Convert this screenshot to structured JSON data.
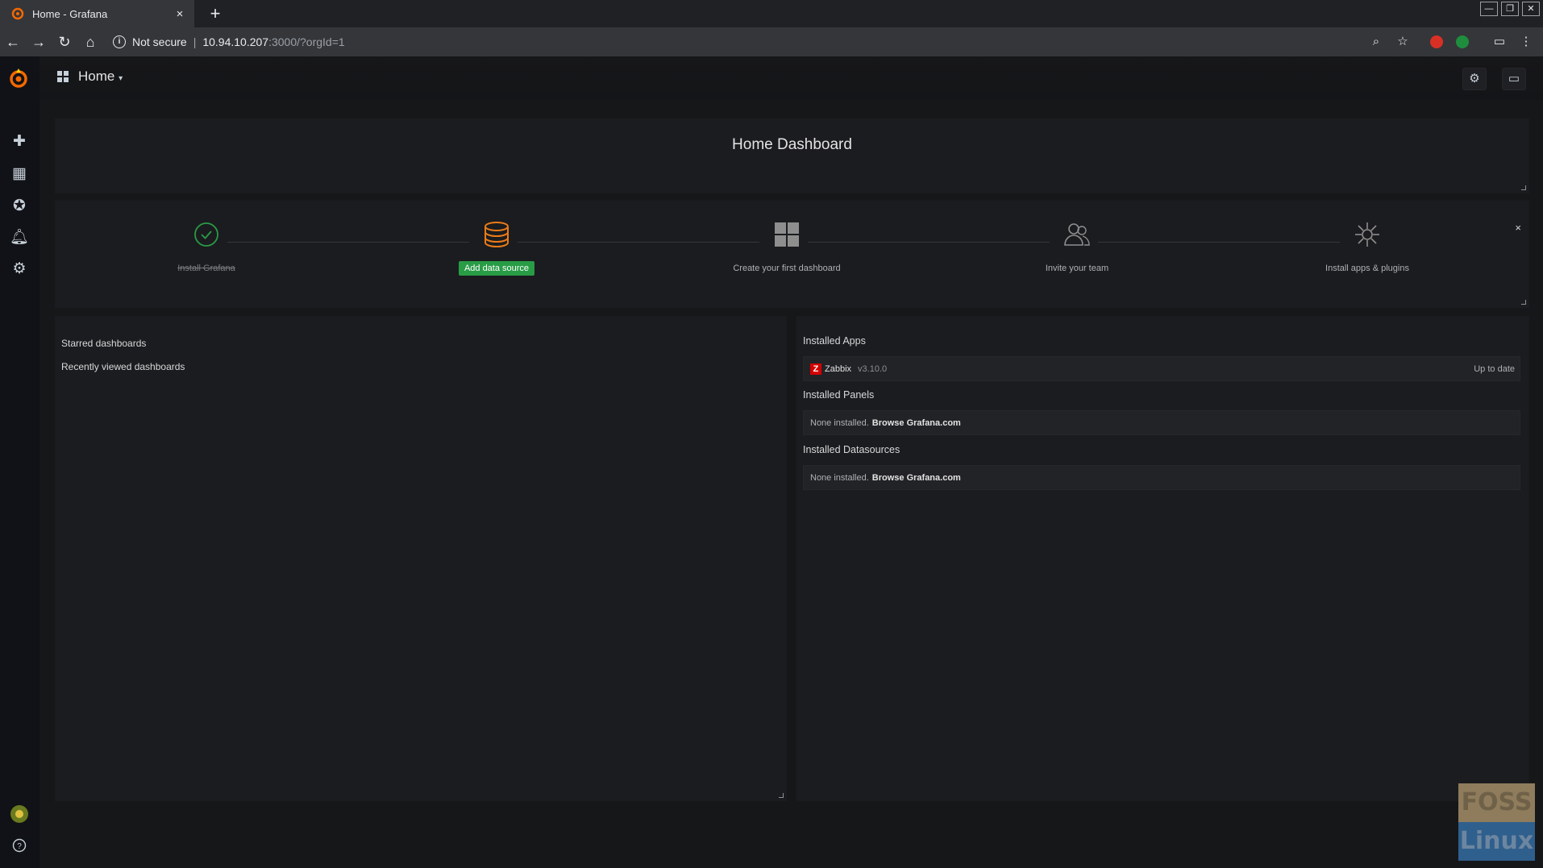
{
  "browser": {
    "tab_title": "Home - Grafana",
    "new_tab": "+",
    "tab_close": "×",
    "not_secure": "Not secure",
    "url_host": "10.94.10.207",
    "url_path": ":3000/?orgId=1",
    "separator": "|"
  },
  "navbar": {
    "dashboard_name": "Home"
  },
  "dashboard": {
    "title": "Home Dashboard"
  },
  "getting_started": {
    "steps": [
      {
        "label": "Install Grafana",
        "state": "done"
      },
      {
        "label": "Add data source",
        "state": "active"
      },
      {
        "label": "Create your first dashboard",
        "state": "todo"
      },
      {
        "label": "Invite your team",
        "state": "todo"
      },
      {
        "label": "Install apps & plugins",
        "state": "todo"
      }
    ],
    "close": "×"
  },
  "dashlist": {
    "starred": "Starred dashboards",
    "recent": "Recently viewed dashboards"
  },
  "plugins": {
    "apps_title": "Installed Apps",
    "app_logo": "Z",
    "app_name": "Zabbix",
    "app_version": "v3.10.0",
    "app_status": "Up to date",
    "panels_title": "Installed Panels",
    "panels_none": "None installed.",
    "panels_browse": "Browse Grafana.com",
    "datasources_title": "Installed Datasources",
    "datasources_none": "None installed.",
    "datasources_browse": "Browse Grafana.com"
  },
  "watermark": {
    "top": "FOSS",
    "bottom": "Linux"
  },
  "colors": {
    "accent_green": "#299c46",
    "grafana_orange": "#eb7b18"
  }
}
